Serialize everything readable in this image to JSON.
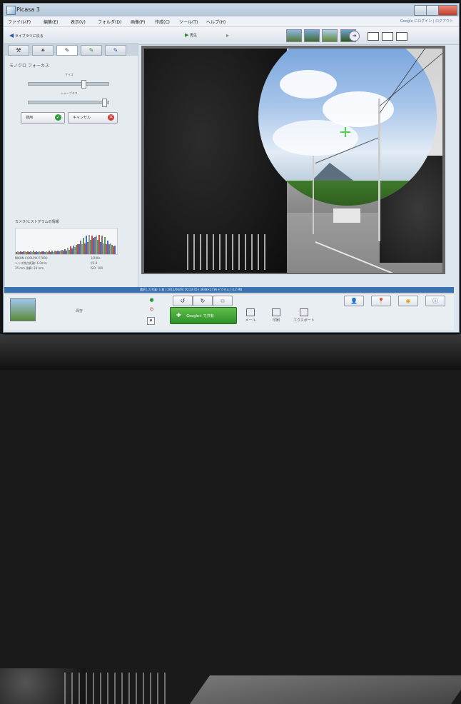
{
  "window": {
    "title": "Picasa 3"
  },
  "menu": {
    "items": [
      "ファイル(F)",
      "編集(E)",
      "表示(V)",
      "フォルダ(D)",
      "画像(P)",
      "作成(C)",
      "ツール(T)",
      "ヘルプ(H)"
    ],
    "account": "Google にログイン | ログアウト"
  },
  "toolbar": {
    "back_label": "ライブラリに戻る",
    "play_label": "再生"
  },
  "tabs": [
    {
      "icon": "wrench-icon",
      "glyph": "🔧"
    },
    {
      "icon": "adjust-icon",
      "glyph": "☀"
    },
    {
      "icon": "brush-icon",
      "glyph": "✎"
    },
    {
      "icon": "green-brush-icon",
      "glyph": "✎"
    },
    {
      "icon": "blue-brush-icon",
      "glyph": "✎"
    }
  ],
  "panel": {
    "title": "モノクロ フォーカス",
    "size_label": "サイズ",
    "sharpness_label": "シャープネス",
    "size_value": 0.7,
    "sharpness_value": 0.97,
    "apply_label": "適用",
    "cancel_label": "キャンセル"
  },
  "histogram": {
    "title": "カメラ/ヒストグラムの情報",
    "camera": "NIKON COOLPIX P7000",
    "lens": "レンズ焦点距離: 6.0mm",
    "focal35": "35 mm 換算: 28 mm",
    "exposure": "1/200s",
    "aperture": "f/2.8",
    "iso": "ISO: 100"
  },
  "status": {
    "text": "選択した写真: 1 枚 | 2011/06/04 10:23:45 | 3648×2736 ピクセル | 4.2 MB"
  },
  "tray": {
    "label": "保存",
    "upload_label": "Google+ で共有",
    "tools": [
      "メール",
      "印刷",
      "エクスポート"
    ]
  },
  "colors": {
    "accent": "#3a72b0",
    "upload": "#2f8f2a",
    "apply_icon": "#2e9b3a",
    "cancel_icon": "#d23b3b"
  }
}
